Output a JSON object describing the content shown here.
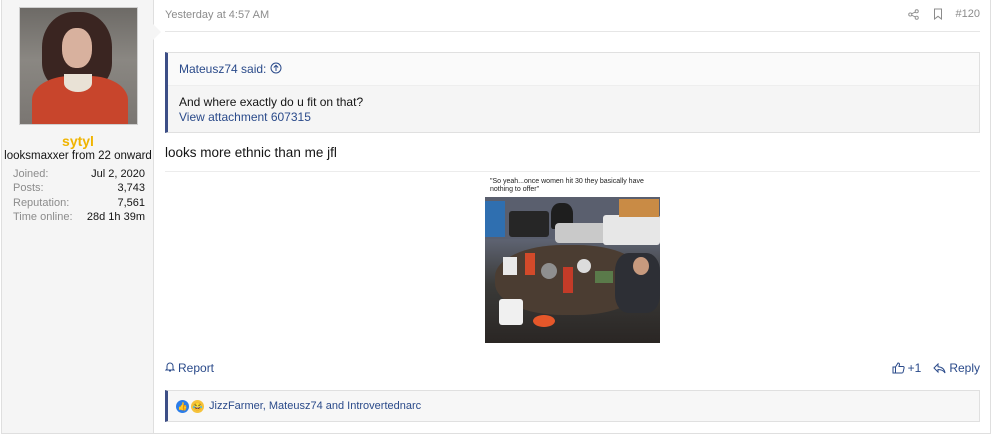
{
  "user": {
    "username": "sytyl",
    "title": "looksmaxxer from 22 onward",
    "stats": [
      {
        "label": "Joined:",
        "value": "Jul 2, 2020"
      },
      {
        "label": "Posts:",
        "value": "3,743"
      },
      {
        "label": "Reputation:",
        "value": "7,561"
      },
      {
        "label": "Time online:",
        "value": "28d 1h 39m"
      }
    ]
  },
  "post": {
    "timestamp": "Yesterday at 4:57 AM",
    "post_number": "#120",
    "quote": {
      "author_line": "Mateusz74 said:",
      "text": "And where exactly do u fit on that?",
      "link": "View attachment 607315"
    },
    "message": "looks more ethnic than me jfl",
    "image_caption": "\"So yeah...once women hit 30 they basically have nothing to offer\"",
    "report_label": "Report",
    "like_label": "+1",
    "reply_label": "Reply",
    "reactions_text": "JizzFarmer, Mateusz74 and Introvertednarc"
  },
  "icons": {
    "share": "share-icon",
    "bookmark": "bookmark-icon",
    "quote_jump": "arrow-up-circle-icon",
    "bell": "bell-icon",
    "thumbs_up": "thumbs-up-icon",
    "reply": "reply-icon",
    "like_reaction": "like-reaction-icon",
    "laugh_reaction": "laugh-reaction-icon"
  },
  "colors": {
    "username": "#f0b400",
    "link": "#2a4a8a",
    "quote_border": "#3c4e86",
    "muted": "#8c8c8c"
  }
}
